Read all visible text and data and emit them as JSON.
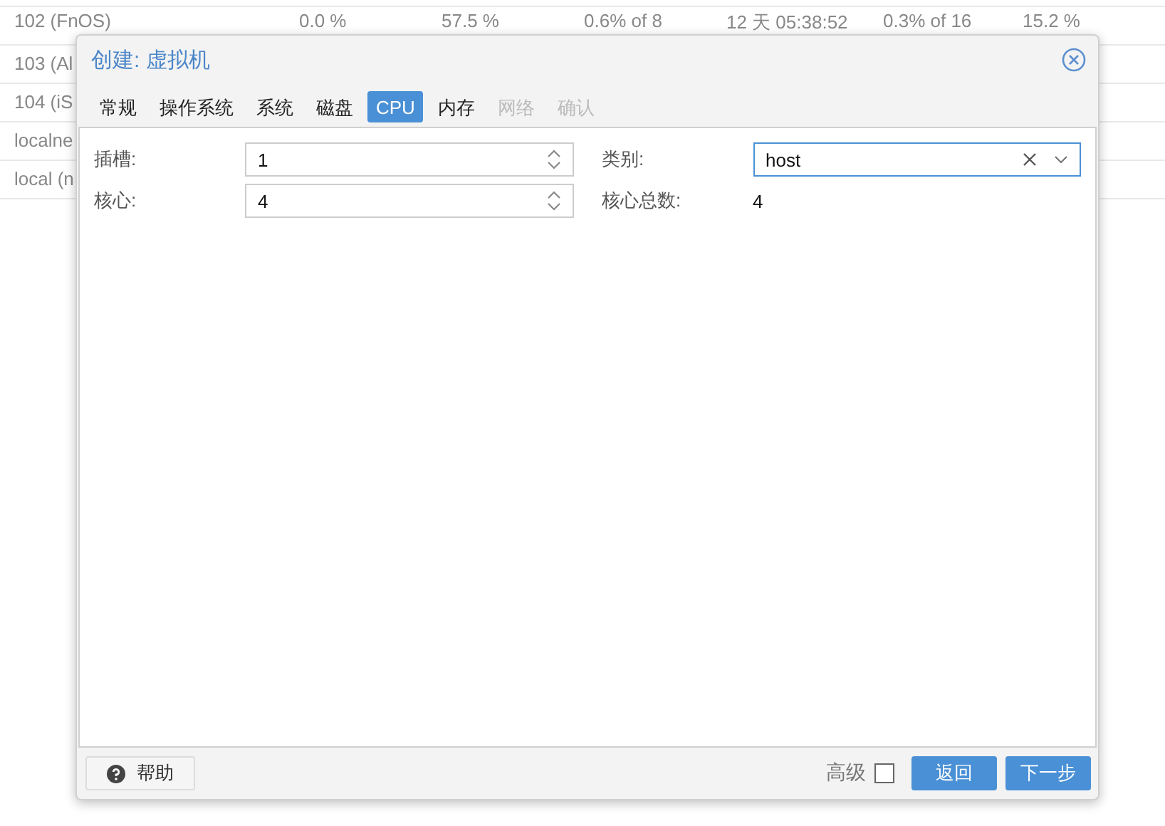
{
  "background_table": {
    "rows": [
      {
        "cells": [
          "102 (FnOS)",
          "0.0 %",
          "57.5 %",
          "0.6% of 8",
          "12 天 05:38:52",
          "0.3% of 16",
          "15.2 %"
        ]
      },
      {
        "cells": [
          "103 (Al"
        ]
      },
      {
        "cells": [
          "104 (iS"
        ]
      },
      {
        "cells": [
          "localne"
        ]
      },
      {
        "cells": [
          "local (n"
        ]
      }
    ]
  },
  "dialog": {
    "title": "创建: 虚拟机",
    "tabs": [
      {
        "label": "常规",
        "selected": false,
        "disabled": false
      },
      {
        "label": "操作系统",
        "selected": false,
        "disabled": false
      },
      {
        "label": "系统",
        "selected": false,
        "disabled": false
      },
      {
        "label": "磁盘",
        "selected": false,
        "disabled": false
      },
      {
        "label": "CPU",
        "selected": true,
        "disabled": false
      },
      {
        "label": "内存",
        "selected": false,
        "disabled": false
      },
      {
        "label": "网络",
        "selected": false,
        "disabled": true
      },
      {
        "label": "确认",
        "selected": false,
        "disabled": true
      }
    ],
    "left_fields": [
      {
        "kind": "spinner",
        "label": "插槽:",
        "value": "1"
      },
      {
        "kind": "spinner",
        "label": "核心:",
        "value": "4"
      }
    ],
    "right_fields": [
      {
        "kind": "combo",
        "label": "类别:",
        "value": "host",
        "focused": true
      },
      {
        "kind": "display",
        "label": "核心总数:",
        "value": "4"
      }
    ],
    "help_button": "帮助",
    "advanced": {
      "label": "高级",
      "checked": false
    },
    "buttons": [
      "返回",
      "下一步"
    ]
  }
}
